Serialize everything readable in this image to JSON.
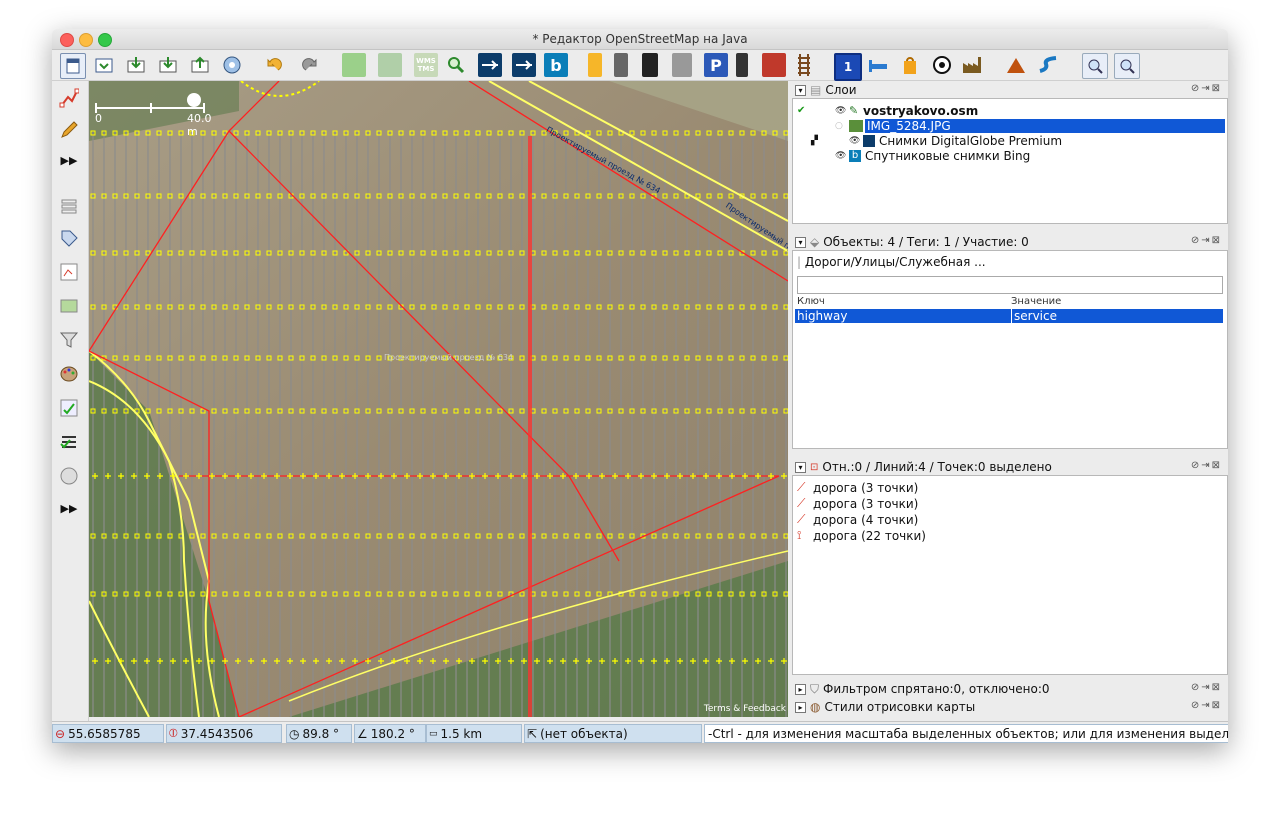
{
  "window": {
    "title": "* Редактор OpenStreetMap на Java"
  },
  "toolbar": {
    "buttons": [
      "new-file-icon",
      "open-file-icon",
      "download-icon",
      "download-overpass-icon",
      "upload-icon",
      "preferences-icon",
      "undo-icon",
      "redo-icon",
      "zoom-to-data-icon",
      "zoom-to-selection-icon",
      "wms-icon",
      "zoom-icon",
      "way-icon-1",
      "way-icon-2",
      "bing-icon",
      "yellow-road-icon",
      "grey-road-icon",
      "black-road-icon",
      "grey-area-icon",
      "parking-icon",
      "traffic-light-icon",
      "wall-icon",
      "rail-icon",
      "number-plate-icon",
      "bed-icon",
      "shop-icon",
      "football-icon",
      "factory-icon",
      "peak-icon",
      "river-icon",
      "zoom-in-icon",
      "zoom-out-icon"
    ],
    "wms_label": "WMS TMS",
    "parking_label": "P",
    "number_label": "1"
  },
  "map": {
    "scale_zero": "0",
    "scale_label": "40.0 m",
    "road_label_1": "Проектируемый проезд № 634",
    "road_label_2": "Проектируемый пр...",
    "road_label_3": "Проектируемый проезд № 634",
    "attribution": "Terms & Feedback"
  },
  "layers": {
    "title": "Слои",
    "items": [
      {
        "name": "vostryakovo.osm",
        "bold": true
      },
      {
        "name": "IMG_5284.JPG",
        "selected": true
      },
      {
        "name": "Снимки DigitalGlobe Premium"
      },
      {
        "name": "Спутниковые снимки Bing"
      }
    ]
  },
  "objects": {
    "title": "Объекты: 4 / Теги: 1 / Участие: 0",
    "preset": "Дороги/Улицы/Служебная ...",
    "col_key": "Ключ",
    "col_value": "Значение",
    "rows": [
      {
        "key": "highway",
        "value": "service"
      }
    ]
  },
  "selection": {
    "title": "Отн.:0 / Линий:4 / Точек:0 выделено",
    "items": [
      "дорога (3 точки)",
      "дорога (3 точки)",
      "дорога (4 точки)",
      "дорога (22 точки)"
    ]
  },
  "filter": {
    "title": "Фильтром спрятано:0, отключено:0"
  },
  "styles": {
    "title": "Стили отрисовки карты"
  },
  "status": {
    "lat": "55.6585785",
    "lon": "37.4543506",
    "heading": "89.8 °",
    "angle": "180.2 °",
    "distance": "1.5 km",
    "object": "(нет объекта)",
    "hint": "-Ctrl - для изменения масштаба выделенных объектов; или для изменения выделения"
  },
  "colors": {
    "selection": "#1058d6",
    "status_field": "#cfe0ef",
    "way_selected": "#ff2020",
    "node": "#ffff00"
  }
}
